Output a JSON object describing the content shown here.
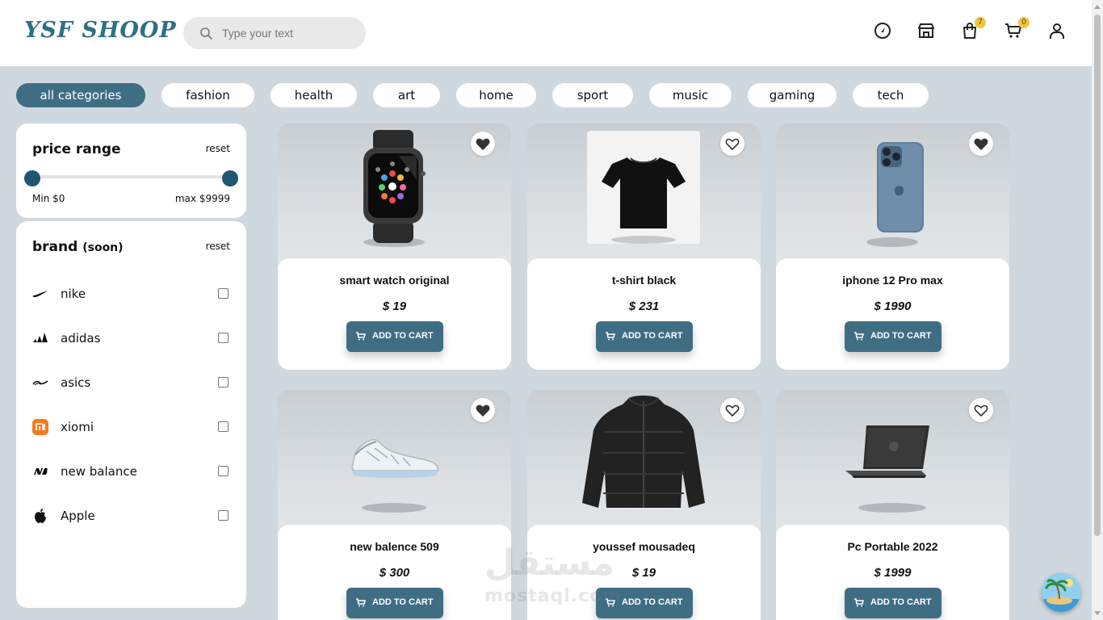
{
  "header": {
    "logo": "YSF SHOOP",
    "search_placeholder": "Type your text",
    "bag_count": "7",
    "cart_count": "0"
  },
  "categories": [
    "all categories",
    "fashion",
    "health",
    "art",
    "home",
    "sport",
    "music",
    "gaming",
    "tech"
  ],
  "price_range": {
    "title": "price range",
    "reset": "reset",
    "min_label": "Min $0",
    "max_label": "max $9999"
  },
  "brand": {
    "title": "brand",
    "soon": "(soon)",
    "reset": "reset",
    "items": [
      {
        "label": "nike",
        "icon": "nike-logo-icon"
      },
      {
        "label": "adidas",
        "icon": "adidas-logo-icon"
      },
      {
        "label": "asics",
        "icon": "asics-logo-icon"
      },
      {
        "label": "xiomi",
        "icon": "xiaomi-logo-icon"
      },
      {
        "label": "new balance",
        "icon": "new-balance-logo-icon"
      },
      {
        "label": "Apple",
        "icon": "apple-logo-icon"
      }
    ]
  },
  "products": [
    {
      "name": "smart watch original",
      "price": "$ 19",
      "favorited": true,
      "image": "smartwatch"
    },
    {
      "name": "t-shirt black",
      "price": "$ 231",
      "favorited": false,
      "image": "tshirt"
    },
    {
      "name": "iphone 12 Pro max",
      "price": "$ 1990",
      "favorited": true,
      "image": "phone"
    },
    {
      "name": "new balence 509",
      "price": "$ 300",
      "favorited": true,
      "image": "sneaker"
    },
    {
      "name": "youssef mousadeq",
      "price": "$ 19",
      "favorited": false,
      "image": "jacket"
    },
    {
      "name": "Pc Portable 2022",
      "price": "$ 1999",
      "favorited": false,
      "image": "laptop"
    }
  ],
  "add_to_cart_label": "ADD TO CART",
  "watermark": {
    "line1": "مستقل",
    "line2": "mostaql.com"
  },
  "colors": {
    "accent": "#3f6d84",
    "background": "#cfd8de",
    "badge": "#f4c542",
    "logo": "#2f6f86"
  }
}
